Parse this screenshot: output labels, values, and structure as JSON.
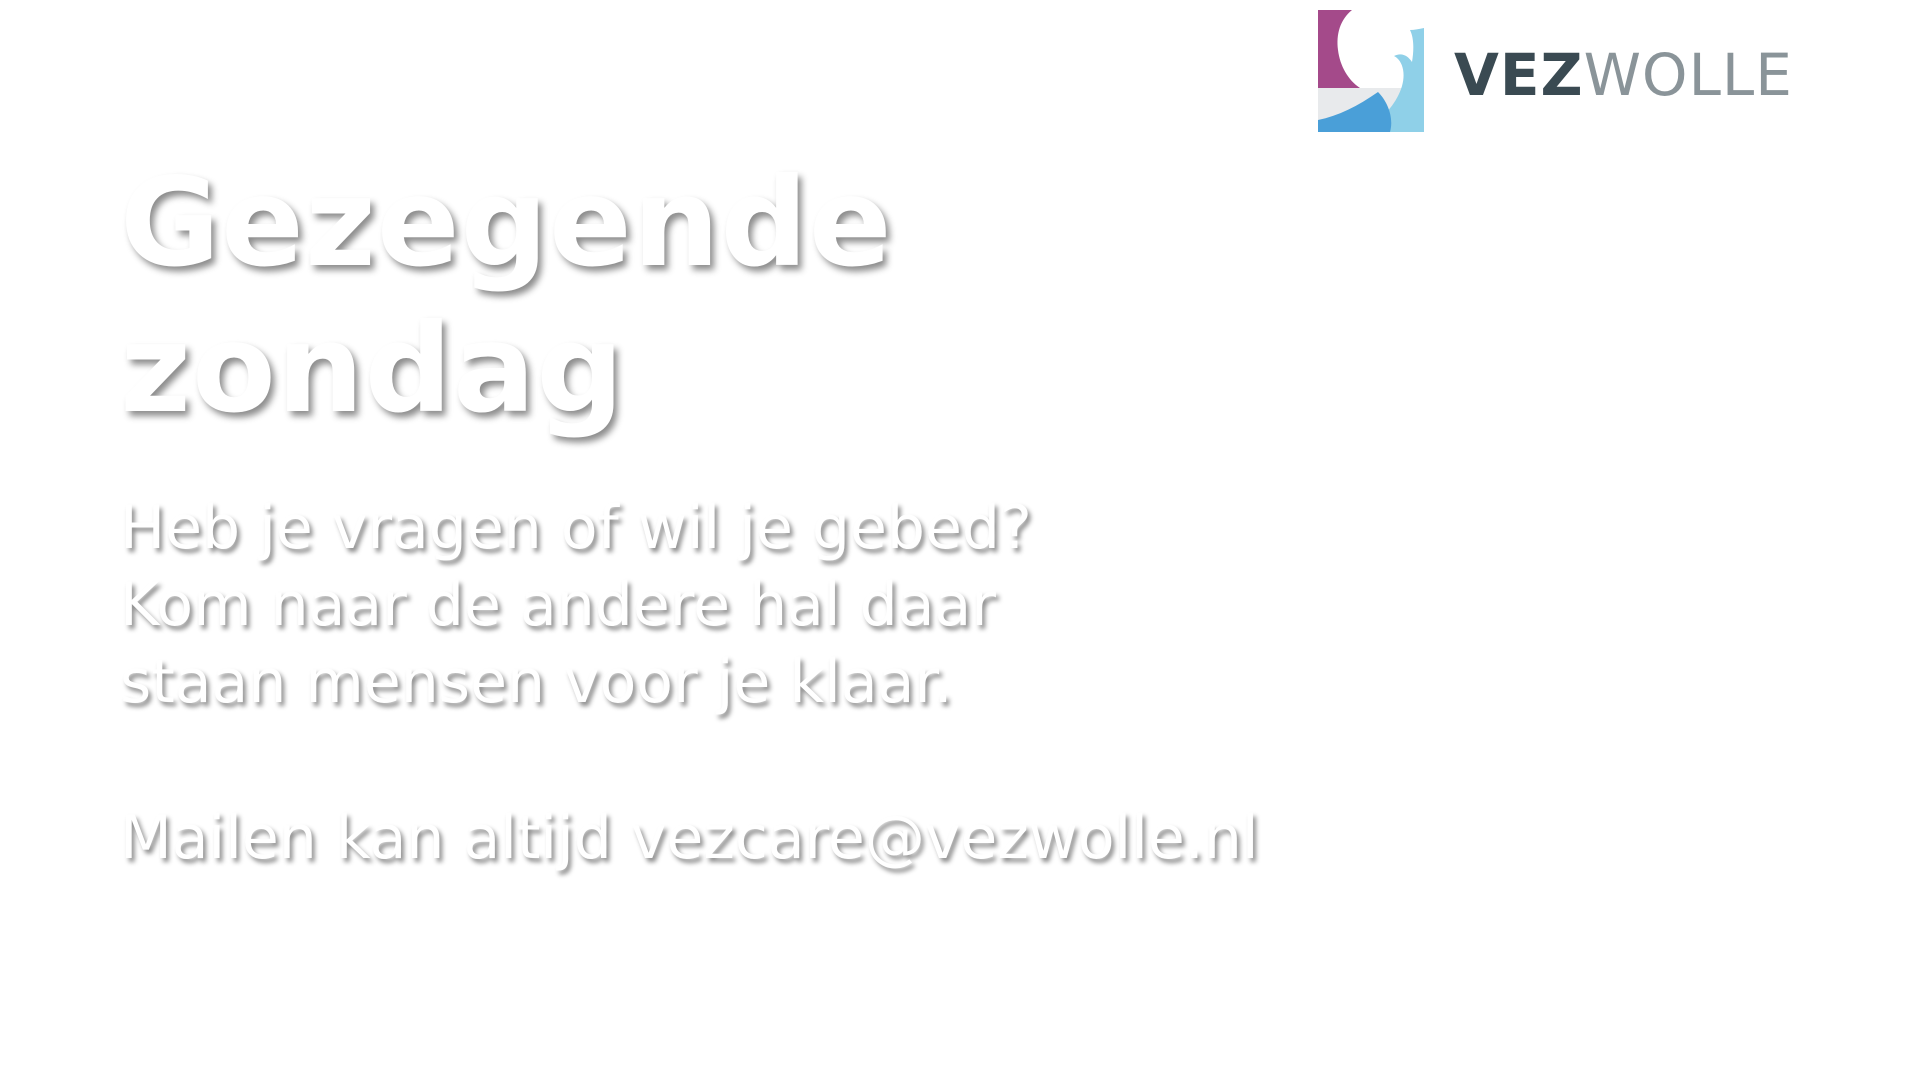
{
  "logo": {
    "word_strong": "VEZ",
    "word_light": "WOLLE",
    "colors": {
      "purple": "#a44a8a",
      "light_blue": "#8fd0e8",
      "mid_blue": "#4a9fd8",
      "light_gray": "#e8eaec",
      "text_dark": "#3a4a52",
      "text_light": "#8a9499"
    }
  },
  "slide": {
    "title_line1": "Gezegende",
    "title_line2": "zondag",
    "body_lines": [
      "Heb je vragen of wil je gebed?",
      "Kom naar de andere hal daar",
      "staan mensen voor je klaar."
    ],
    "contact": "Mailen kan altijd vezcare@vezwolle.nl"
  },
  "colors": {
    "background": "#ffffff",
    "text": "#ffffff"
  }
}
